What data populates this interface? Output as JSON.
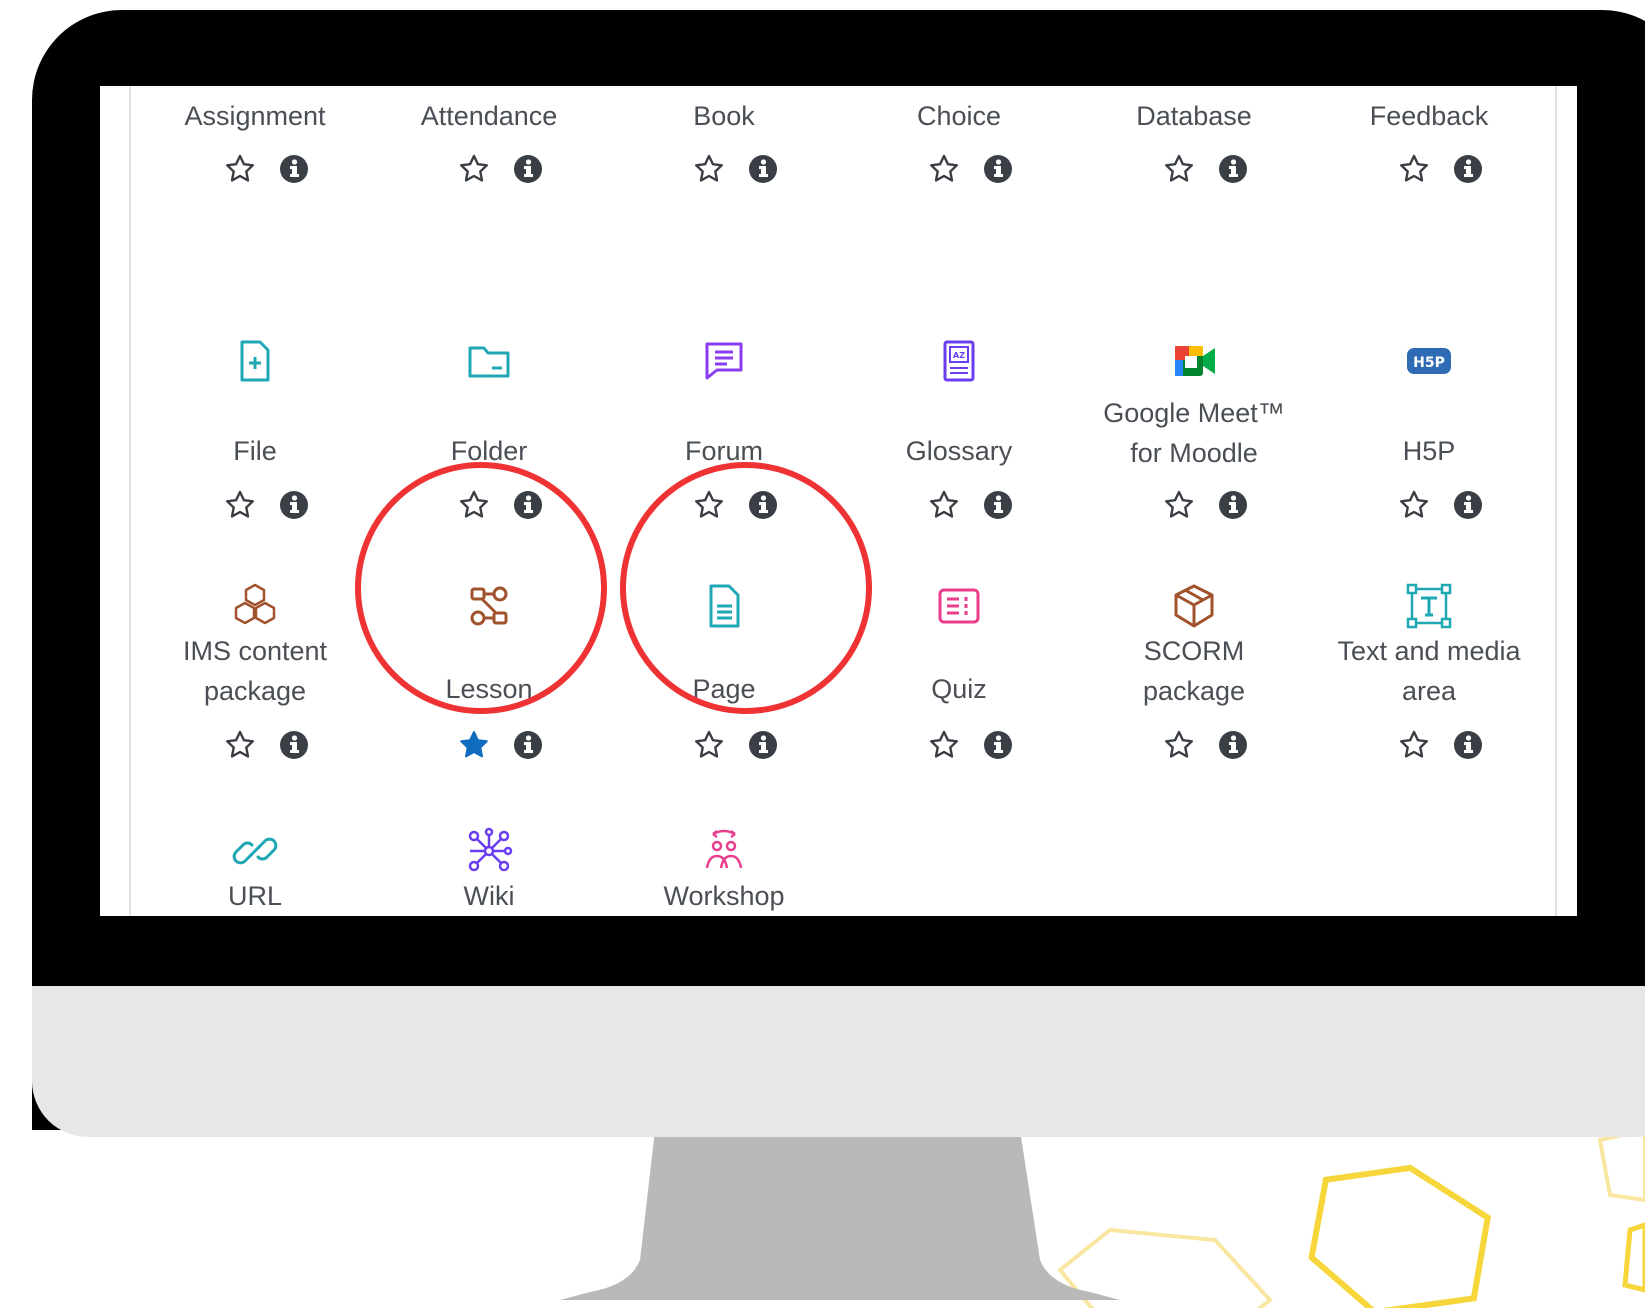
{
  "colors": {
    "frame": "#000000",
    "chin": "#e7e7e7",
    "stand": "#b9b9b9",
    "highlight_ring": "#ef3233",
    "starred": "#0f6cbf",
    "text": "#4a4f55",
    "hexagon": "#f6d63a"
  },
  "activities": [
    {
      "name": "Assignment",
      "icon": "assignment-icon",
      "starred": false
    },
    {
      "name": "Attendance",
      "icon": "attendance-icon",
      "starred": false
    },
    {
      "name": "Book",
      "icon": "book-icon",
      "starred": false
    },
    {
      "name": "Choice",
      "icon": "choice-icon",
      "starred": false
    },
    {
      "name": "Database",
      "icon": "database-icon",
      "starred": false
    },
    {
      "name": "Feedback",
      "icon": "feedback-icon",
      "starred": false
    },
    {
      "name": "File",
      "icon": "file-icon",
      "starred": false
    },
    {
      "name": "Folder",
      "icon": "folder-icon",
      "starred": false
    },
    {
      "name": "Forum",
      "icon": "forum-icon",
      "starred": false
    },
    {
      "name": "Glossary",
      "icon": "glossary-icon",
      "starred": false
    },
    {
      "name": "Google Meet™\nfor Moodle",
      "icon": "google-meet-icon",
      "starred": false
    },
    {
      "name": "H5P",
      "icon": "h5p-icon",
      "starred": false
    },
    {
      "name": "IMS content\npackage",
      "icon": "ims-package-icon",
      "starred": false
    },
    {
      "name": "Lesson",
      "icon": "lesson-icon",
      "starred": true,
      "highlighted": true
    },
    {
      "name": "Page",
      "icon": "page-icon",
      "starred": false,
      "highlighted": true
    },
    {
      "name": "Quiz",
      "icon": "quiz-icon",
      "starred": false
    },
    {
      "name": "SCORM\npackage",
      "icon": "scorm-package-icon",
      "starred": false
    },
    {
      "name": "Text and media\narea",
      "icon": "text-media-icon",
      "starred": false
    },
    {
      "name": "URL",
      "icon": "url-icon",
      "starred": false
    },
    {
      "name": "Wiki",
      "icon": "wiki-icon",
      "starred": false
    },
    {
      "name": "Workshop",
      "icon": "workshop-icon",
      "starred": false
    }
  ]
}
